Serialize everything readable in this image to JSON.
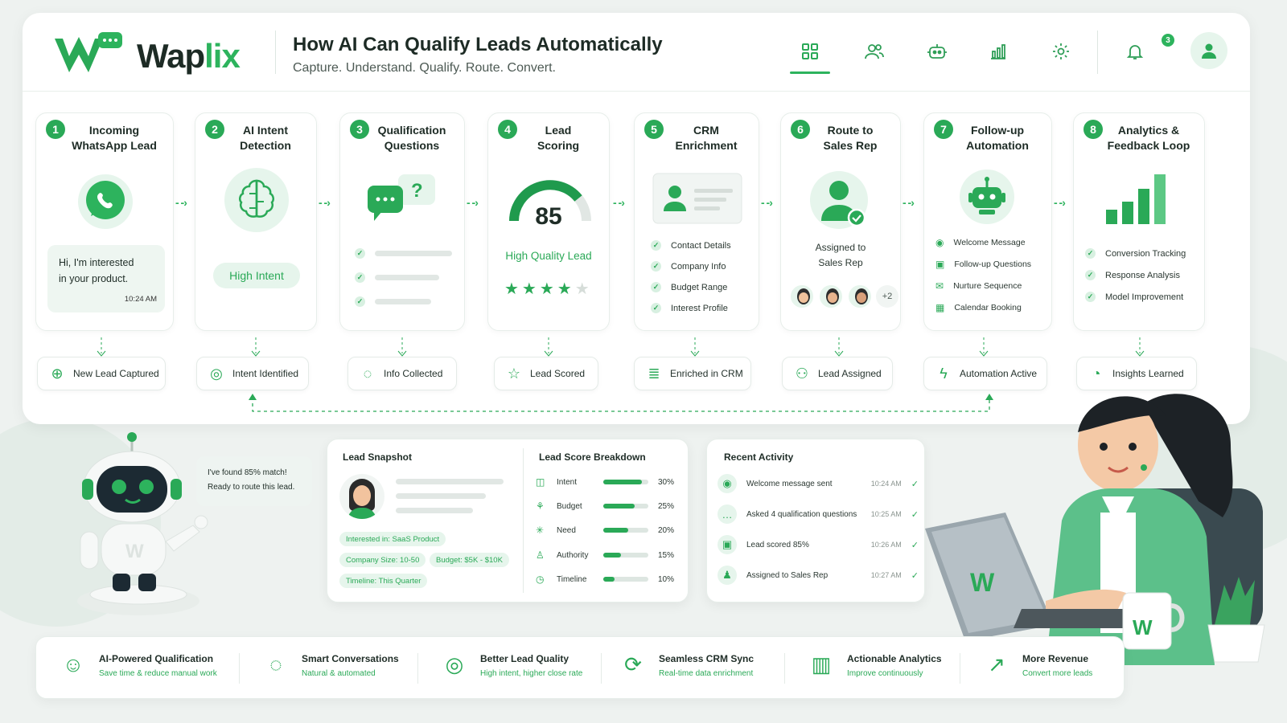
{
  "brand": {
    "name_a": "Wap",
    "name_b": "lix",
    "accent": "#2db35d"
  },
  "header": {
    "title": "How AI Can Qualify Leads Automatically",
    "subtitle": "Capture. Understand. Qualify. Route. Convert.",
    "nav": [
      "dashboard-icon",
      "users-icon",
      "bot-icon",
      "chart-icon",
      "gear-icon"
    ],
    "notifications": "3"
  },
  "steps": [
    {
      "num": "1",
      "title_1": "Incoming",
      "title_2": "WhatsApp Lead",
      "message_1": "Hi, I'm interested",
      "message_2": "in your product.",
      "time": "10:24 AM",
      "chip": "New Lead Captured"
    },
    {
      "num": "2",
      "title_1": "AI Intent",
      "title_2": "Detection",
      "badge": "High Intent",
      "chip": "Intent Identified"
    },
    {
      "num": "3",
      "title_1": "Qualification",
      "title_2": "Questions",
      "chip": "Info Collected"
    },
    {
      "num": "4",
      "title_1": "Lead",
      "title_2": "Scoring",
      "score": "85",
      "score_label": "High Quality Lead",
      "rating": 4,
      "chip": "Lead Scored"
    },
    {
      "num": "5",
      "title_1": "CRM",
      "title_2": "Enrichment",
      "items": [
        "Contact Details",
        "Company Info",
        "Budget Range",
        "Interest Profile"
      ],
      "chip": "Enriched in CRM"
    },
    {
      "num": "6",
      "title_1": "Route to",
      "title_2": "Sales Rep",
      "assigned_1": "Assigned to",
      "assigned_2": "Sales Rep",
      "more": "+2",
      "chip": "Lead Assigned"
    },
    {
      "num": "7",
      "title_1": "Follow-up",
      "title_2": "Automation",
      "items": [
        "Welcome Message",
        "Follow-up Questions",
        "Nurture Sequence",
        "Calendar Booking"
      ],
      "chip": "Automation Active"
    },
    {
      "num": "8",
      "title_1": "Analytics &",
      "title_2": "Feedback Loop",
      "items": [
        "Conversion Tracking",
        "Response Analysis",
        "Model Improvement"
      ],
      "chip": "Insights Learned"
    }
  ],
  "robot_bubble": {
    "line1": "I've found 85% match!",
    "line2": "Ready to route this lead."
  },
  "snapshot": {
    "title": "Lead Snapshot",
    "tags": [
      "Interested in: SaaS Product",
      "Company Size: 10-50",
      "Budget: $5K - $10K",
      "Timeline: This Quarter"
    ]
  },
  "breakdown": {
    "title": "Lead Score Breakdown",
    "rows": [
      {
        "label": "Intent",
        "value": "30%",
        "fill": 0.85
      },
      {
        "label": "Budget",
        "value": "25%",
        "fill": 0.7
      },
      {
        "label": "Need",
        "value": "20%",
        "fill": 0.55
      },
      {
        "label": "Authority",
        "value": "15%",
        "fill": 0.4
      },
      {
        "label": "Timeline",
        "value": "10%",
        "fill": 0.25
      }
    ]
  },
  "activity": {
    "title": "Recent Activity",
    "rows": [
      {
        "text": "Welcome message sent",
        "time": "10:24 AM"
      },
      {
        "text": "Asked 4 qualification questions",
        "time": "10:25 AM"
      },
      {
        "text": "Lead scored 85%",
        "time": "10:26 AM"
      },
      {
        "text": "Assigned to Sales Rep",
        "time": "10:27 AM"
      }
    ]
  },
  "features": [
    {
      "title": "AI-Powered Qualification",
      "sub": "Save time & reduce manual work"
    },
    {
      "title": "Smart Conversations",
      "sub": "Natural & automated"
    },
    {
      "title": "Better Lead Quality",
      "sub": "High intent, higher close rate"
    },
    {
      "title": "Seamless CRM Sync",
      "sub": "Real-time data enrichment"
    },
    {
      "title": "Actionable Analytics",
      "sub": "Improve continuously"
    },
    {
      "title": "More Revenue",
      "sub": "Convert more leads"
    }
  ]
}
